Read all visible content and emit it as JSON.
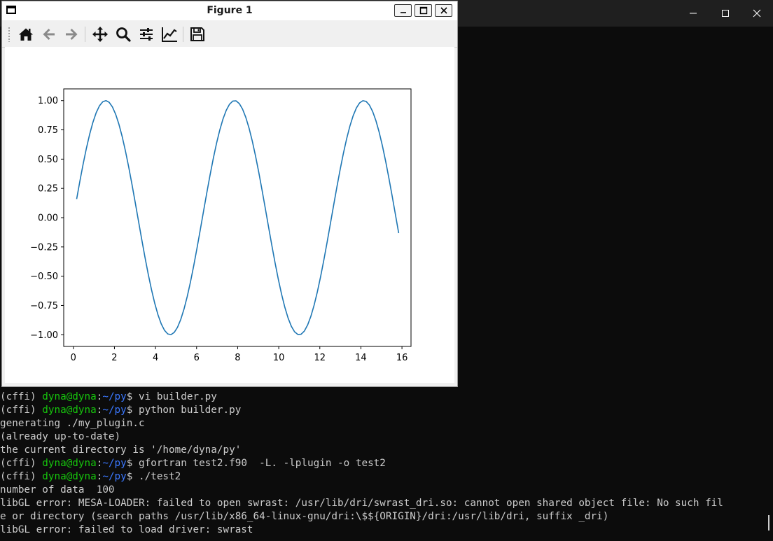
{
  "terminal_window": {
    "controls": {
      "minimize_icon": "minimize-icon",
      "maximize_icon": "maximize-icon",
      "close_icon": "close-icon"
    }
  },
  "terminal": {
    "lines": [
      {
        "type": "prompt",
        "env": "(cffi) ",
        "user": "dyna@dyna",
        "sep": ":",
        "path": "~/py",
        "cmd": "$ vi builder.py"
      },
      {
        "type": "prompt",
        "env": "(cffi) ",
        "user": "dyna@dyna",
        "sep": ":",
        "path": "~/py",
        "cmd": "$ python builder.py"
      },
      {
        "type": "output",
        "text": "generating ./my_plugin.c"
      },
      {
        "type": "output",
        "text": "(already up-to-date)"
      },
      {
        "type": "output",
        "text": "the current directory is '/home/dyna/py'"
      },
      {
        "type": "prompt",
        "env": "(cffi) ",
        "user": "dyna@dyna",
        "sep": ":",
        "path": "~/py",
        "cmd": "$ gfortran test2.f90  -L. -lplugin -o test2"
      },
      {
        "type": "prompt",
        "env": "(cffi) ",
        "user": "dyna@dyna",
        "sep": ":",
        "path": "~/py",
        "cmd": "$ ./test2"
      },
      {
        "type": "output",
        "text": "number of data  100"
      },
      {
        "type": "output",
        "text": "libGL error: MESA-LOADER: failed to open swrast: /usr/lib/dri/swrast_dri.so: cannot open shared object file: No such fil"
      },
      {
        "type": "output",
        "text": "e or directory (search paths /usr/lib/x86_64-linux-gnu/dri:\\$${ORIGIN}/dri:/usr/lib/dri, suffix _dri)"
      },
      {
        "type": "output",
        "text": "libGL error: failed to load driver: swrast"
      }
    ],
    "colors": {
      "text": "#cccccc",
      "user": "#16c60c",
      "path": "#3b78ff",
      "background": "#0c0c0c"
    }
  },
  "figure_window": {
    "title": "Figure 1",
    "toolbar": {
      "buttons": [
        "home-icon",
        "back-arrow-icon",
        "forward-arrow-icon",
        "pan-icon",
        "zoom-icon",
        "subplots-config-icon",
        "edit-axis-icon",
        "save-icon"
      ]
    }
  },
  "chart_data": {
    "type": "line",
    "title": "",
    "xlabel": "",
    "ylabel": "",
    "xlim": [
      -0.47,
      16.44
    ],
    "ylim": [
      -1.1,
      1.1
    ],
    "xticks": [
      0,
      2,
      4,
      6,
      8,
      10,
      12,
      14,
      16
    ],
    "yticks": [
      1.0,
      0.75,
      0.5,
      0.25,
      0.0,
      -0.25,
      -0.5,
      -0.75,
      -1.0
    ],
    "xtick_labels": [
      "0",
      "2",
      "4",
      "6",
      "8",
      "10",
      "12",
      "14",
      "16"
    ],
    "ytick_labels": [
      "1.00",
      "0.75",
      "0.50",
      "0.25",
      "0.00",
      "−0.25",
      "−0.50",
      "−0.75",
      "−1.00"
    ],
    "series": [
      {
        "function": "sin(x)",
        "x_start": 0.16,
        "x_end": 15.84,
        "n_points": 100,
        "color": "#1f77b4"
      }
    ],
    "grid": false,
    "legend": false
  }
}
